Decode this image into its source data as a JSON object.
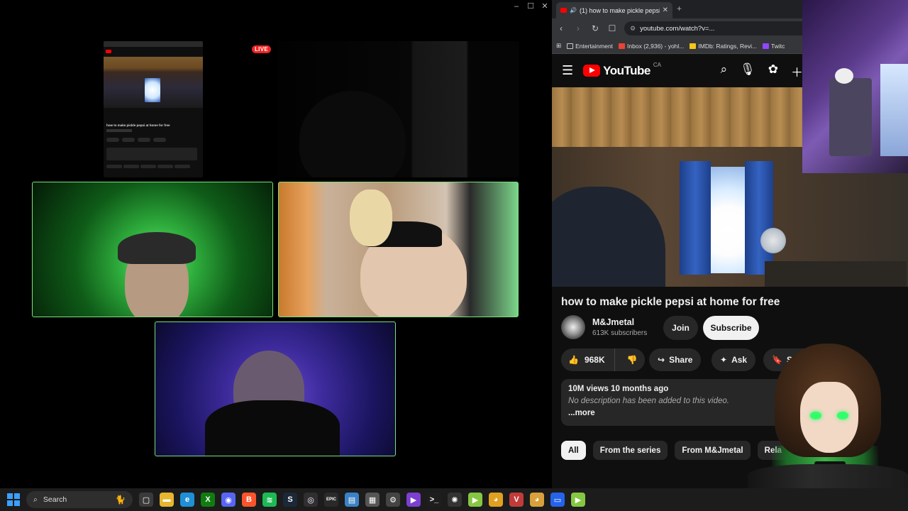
{
  "call": {
    "live_label": "LIVE",
    "window_controls": [
      "–",
      "☐",
      "✕"
    ],
    "screen_share": {
      "video_title": "how to make pickle pepsi at home for free"
    }
  },
  "browser": {
    "tab": {
      "title": "(1) how to make pickle pepsi",
      "close": "✕"
    },
    "new_tab": "+",
    "url": "youtube.com/watch?v=...",
    "bookmarks": [
      {
        "label": "Entertainment",
        "color": "#c9c9c9"
      },
      {
        "label": "Inbox (2,936) - yohl...",
        "color": "#ea4335"
      },
      {
        "label": "IMDb: Ratings, Revi...",
        "color": "#f5c518"
      },
      {
        "label": "Twitc",
        "color": "#9146ff"
      }
    ]
  },
  "youtube": {
    "logo_text": "YouTube",
    "country": "CA",
    "video_title": "how to make pickle pepsi at home for free",
    "channel": {
      "name": "M&Jmetal",
      "subscribers": "613K subscribers"
    },
    "join_label": "Join",
    "subscribe_label": "Subscribe",
    "likes": "968K",
    "share_label": "Share",
    "ask_label": "Ask",
    "save_label": "Save",
    "description": {
      "meta": "10M views  10 months ago",
      "text": "No description has been added to this video.",
      "more": "...more"
    },
    "chips": [
      {
        "label": "All",
        "active": true
      },
      {
        "label": "From the series",
        "active": false
      },
      {
        "label": "From M&Jmetal",
        "active": false
      },
      {
        "label": "Rela",
        "active": false
      }
    ]
  },
  "taskbar": {
    "search_placeholder": "Search",
    "pinned": [
      {
        "name": "task-view",
        "color": "#3a3a3a",
        "glyph": "▢"
      },
      {
        "name": "file-explorer",
        "color": "#e8b530",
        "glyph": "▬"
      },
      {
        "name": "edge",
        "color": "#1f8fd6",
        "glyph": "e"
      },
      {
        "name": "xbox",
        "color": "#107c10",
        "glyph": "X"
      },
      {
        "name": "discord",
        "color": "#5865f2",
        "glyph": "◉"
      },
      {
        "name": "brave",
        "color": "#fb542b",
        "glyph": "B"
      },
      {
        "name": "spotify",
        "color": "#1db954",
        "glyph": "≋"
      },
      {
        "name": "steam",
        "color": "#1b2838",
        "glyph": "S"
      },
      {
        "name": "obs",
        "color": "#302e31",
        "glyph": "◎"
      },
      {
        "name": "epic-games",
        "color": "#2a2a2a",
        "glyph": "EPIC"
      },
      {
        "name": "notepad",
        "color": "#3b82c4",
        "glyph": "▤"
      },
      {
        "name": "calculator",
        "color": "#555",
        "glyph": "▦"
      },
      {
        "name": "settings",
        "color": "#444",
        "glyph": "⚙"
      },
      {
        "name": "media-app",
        "color": "#7b3fd1",
        "glyph": "▶"
      },
      {
        "name": "terminal",
        "color": "#1e1e1e",
        "glyph": ">_"
      },
      {
        "name": "steelseries",
        "color": "#333",
        "glyph": "✺"
      },
      {
        "name": "rumble",
        "color": "#85c742",
        "glyph": "▶"
      },
      {
        "name": "chrome",
        "color": "#e0a020",
        "glyph": "◕"
      },
      {
        "name": "vivaldi",
        "color": "#c23b3b",
        "glyph": "V"
      },
      {
        "name": "chrome-active",
        "color": "#d9a13b",
        "glyph": "◕"
      },
      {
        "name": "app-blue",
        "color": "#2563eb",
        "glyph": "▭"
      },
      {
        "name": "rumble-2",
        "color": "#85c742",
        "glyph": "▶"
      }
    ]
  }
}
